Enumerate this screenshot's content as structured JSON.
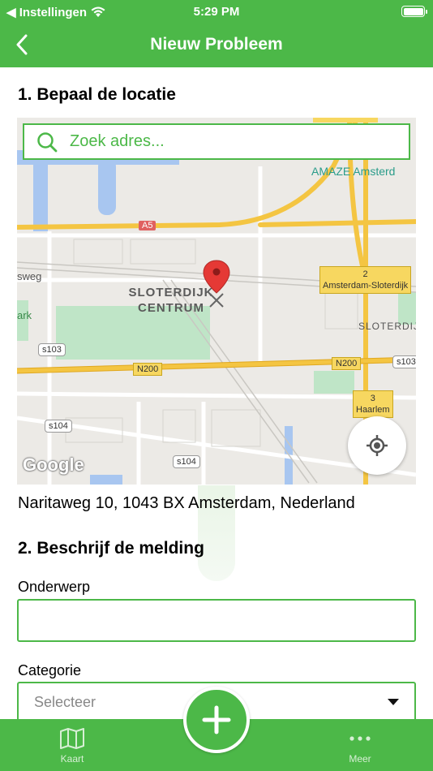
{
  "status_bar": {
    "carrier": "◀ Instellingen",
    "time": "5:29 PM"
  },
  "nav": {
    "title": "Nieuw Probleem"
  },
  "section_location": {
    "title": "1. Bepaal de locatie"
  },
  "map": {
    "search_placeholder": "Zoek adres...",
    "place_name": "SLOTERDIJK CENTRUM",
    "poi_top": "AMAZE Amsterd",
    "poi_right": "SLOTERDIJ",
    "area_left_1": "sweg",
    "area_left_2": "ark",
    "highway_a5": "A5",
    "road_n200_left": "N200",
    "road_n200_right": "N200",
    "road_s103_left": "s103",
    "road_s103_right": "s103",
    "road_s104_left": "s104",
    "road_s104_bottom": "s104",
    "exit_2_number": "2",
    "exit_2_name": "Amsterdam-Sloterdijk",
    "exit_3_number": "3",
    "exit_3_name": "Haarlem",
    "attribution": "Google"
  },
  "address": "Naritaweg 10, 1043 BX Amsterdam, Nederland",
  "section_description": {
    "title": "2. Beschrijf de melding",
    "subject_label": "Onderwerp",
    "subject_value": "",
    "category_label": "Categorie",
    "category_value": "Selecteer"
  },
  "tab_bar": {
    "left_label": "Kaart",
    "right_label": "Meer",
    "fab_icon": "plus-icon"
  },
  "colors": {
    "accent": "#4cb848",
    "white": "#ffffff"
  }
}
